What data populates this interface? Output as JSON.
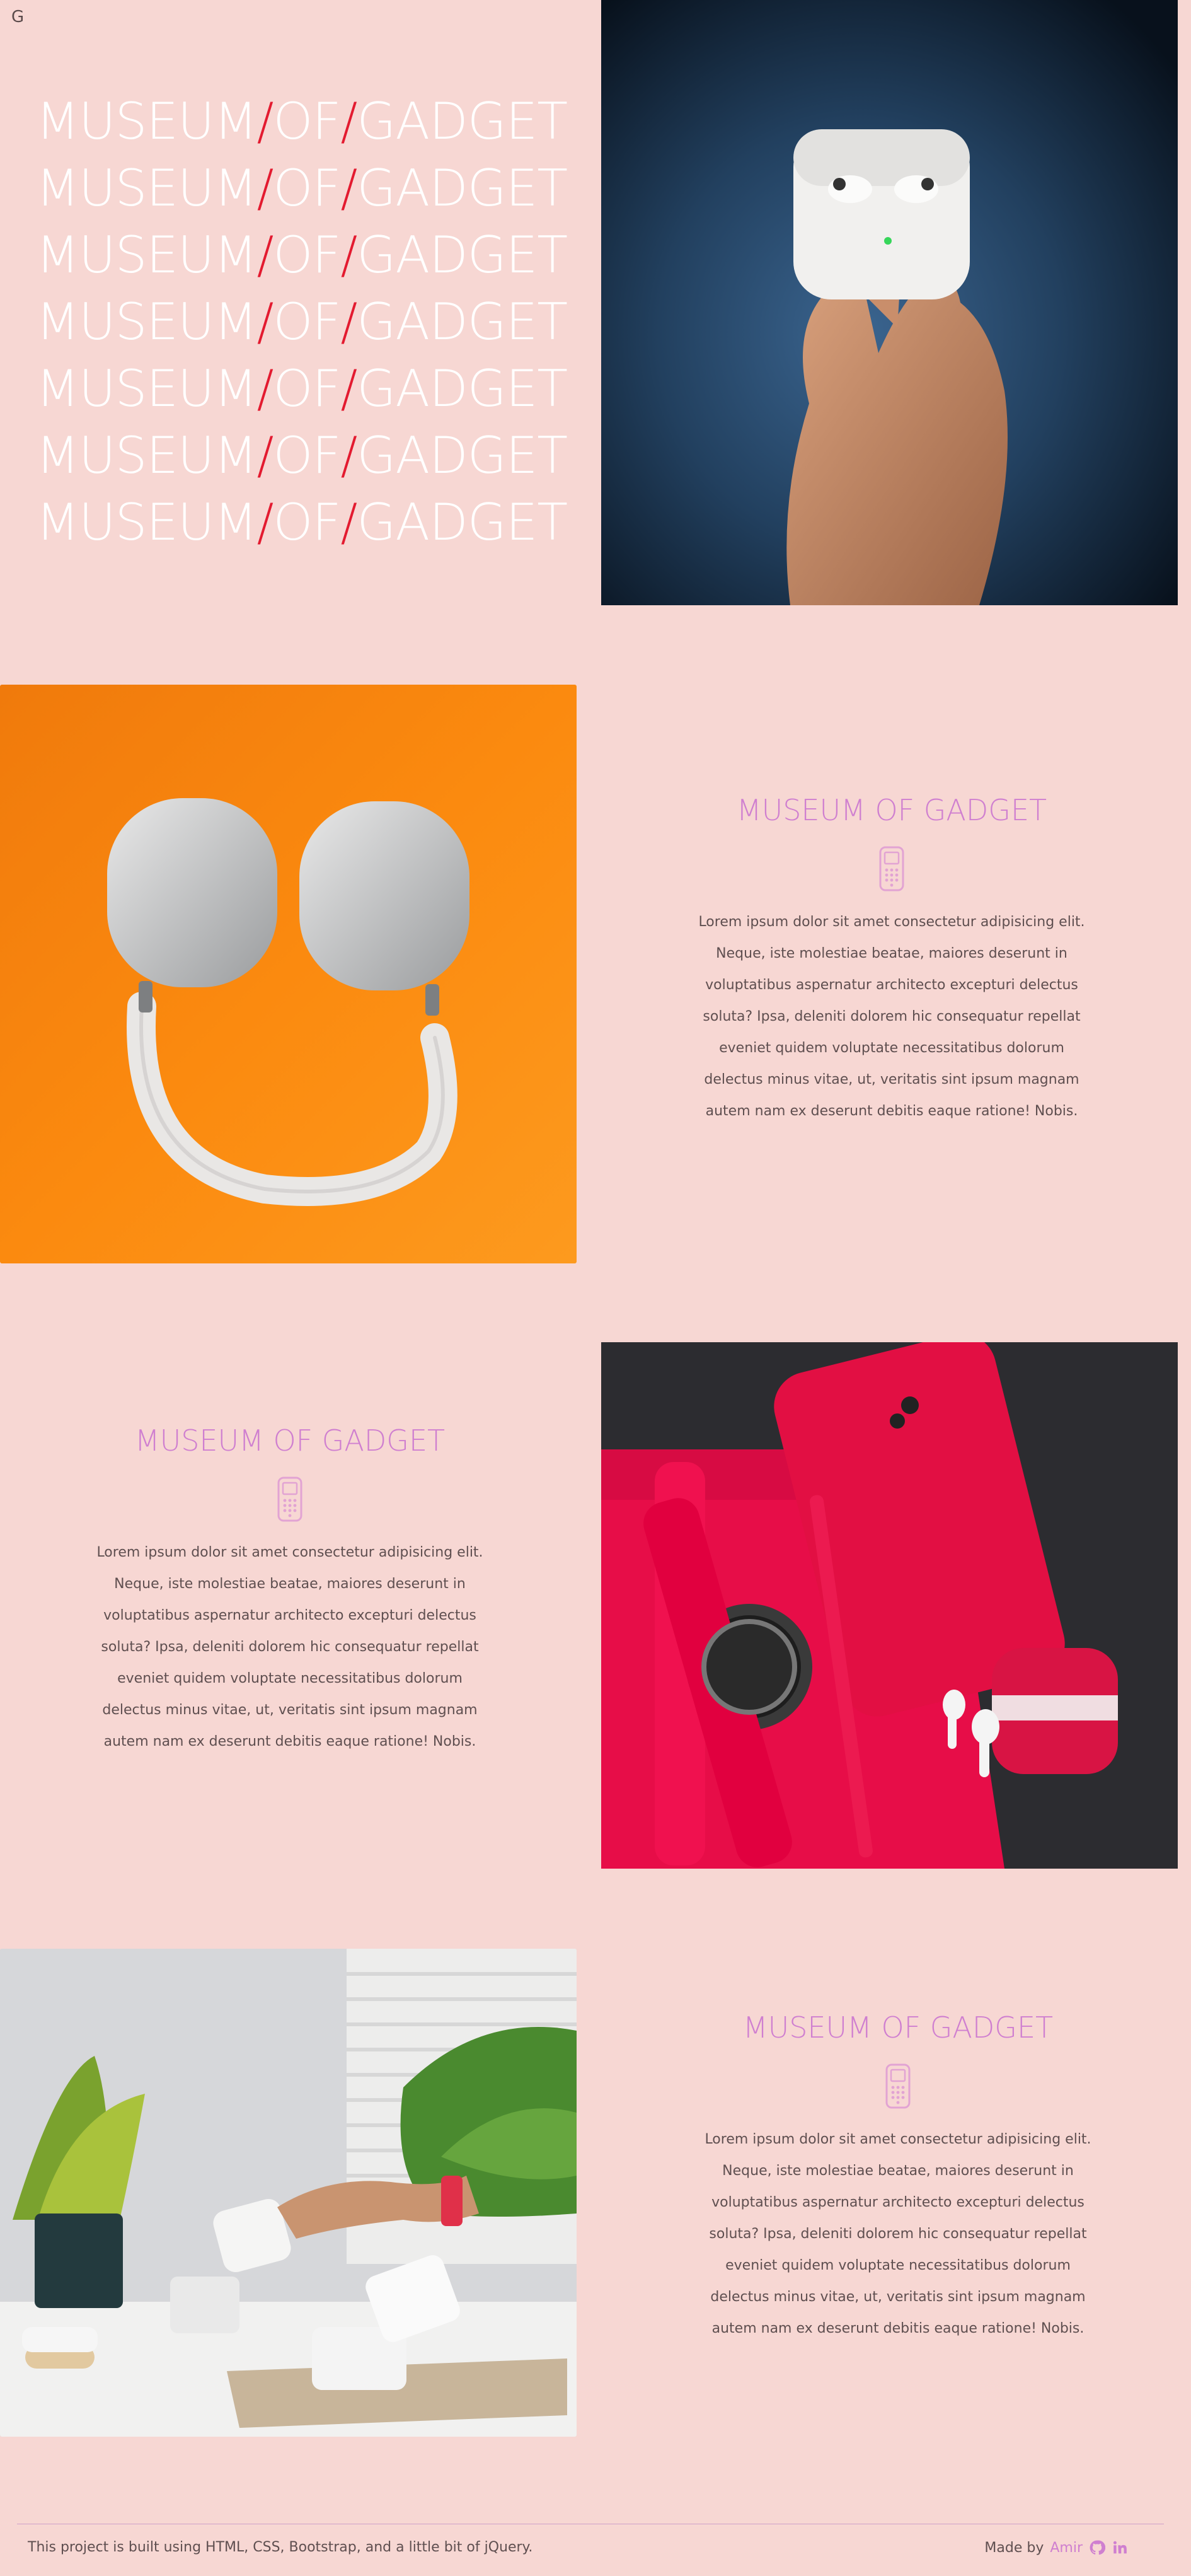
{
  "brand": {
    "corner_mark": "G"
  },
  "hero": {
    "lines": [
      {
        "a": "MUSEUM",
        "s1": "/",
        "b": "OF",
        "s2": "/",
        "c": "GADGET"
      },
      {
        "a": "MUSEUM",
        "s1": "/",
        "b": "OF",
        "s2": "/",
        "c": "GADGET"
      },
      {
        "a": "MUSEUM",
        "s1": "/",
        "b": "OF",
        "s2": "/",
        "c": "GADGET"
      },
      {
        "a": "MUSEUM",
        "s1": "/",
        "b": "OF",
        "s2": "/",
        "c": "GADGET"
      },
      {
        "a": "MUSEUM",
        "s1": "/",
        "b": "OF",
        "s2": "/",
        "c": "GADGET"
      },
      {
        "a": "MUSEUM",
        "s1": "/",
        "b": "OF",
        "s2": "/",
        "c": "GADGET"
      },
      {
        "a": "MUSEUM",
        "s1": "/",
        "b": "OF",
        "s2": "/",
        "c": "GADGET"
      }
    ],
    "slash_color": "#e31b30"
  },
  "sections": [
    {
      "title": "MUSEUM OF GADGET",
      "icon": "mobile-phone-icon",
      "body": "Lorem ipsum dolor sit amet consectetur adipisicing elit. Neque, iste molestiae beatae, maiores deserunt in voluptatibus aspernatur architecto excepturi delectus soluta? Ipsa, deleniti dolorem hic consequatur repellat eveniet quidem voluptate necessitatibus dolorum delectus minus vitae, ut, veritatis sint ipsum magnam autem nam ex deserunt debitis eaque ratione! Nobis."
    },
    {
      "title": "MUSEUM OF GADGET",
      "icon": "mobile-phone-icon",
      "body": "Lorem ipsum dolor sit amet consectetur adipisicing elit. Neque, iste molestiae beatae, maiores deserunt in voluptatibus aspernatur architecto excepturi delectus soluta? Ipsa, deleniti dolorem hic consequatur repellat eveniet quidem voluptate necessitatibus dolorum delectus minus vitae, ut, veritatis sint ipsum magnam autem nam ex deserunt debitis eaque ratione! Nobis."
    },
    {
      "title": "MUSEUM OF GADGET",
      "icon": "mobile-phone-icon",
      "body": "Lorem ipsum dolor sit amet consectetur adipisicing elit. Neque, iste molestiae beatae, maiores deserunt in voluptatibus aspernatur architecto excepturi delectus soluta? Ipsa, deleniti dolorem hic consequatur repellat eveniet quidem voluptate necessitatibus dolorum delectus minus vitae, ut, veritatis sint ipsum magnam autem nam ex deserunt debitis eaque ratione! Nobis."
    }
  ],
  "photos": [
    {
      "name": "airpods-pro-photo",
      "subject": "airpods-icon"
    },
    {
      "name": "airpods-max-photo",
      "subject": "headphones-icon"
    },
    {
      "name": "red-gadgets-photo",
      "subject": "smartphone-icon"
    },
    {
      "name": "charger-photo",
      "subject": "power-adapter-icon"
    }
  ],
  "footer": {
    "note": "This project is built using HTML, CSS, Bootstrap, and a little bit of jQuery.",
    "made_by": "Made by",
    "author": "Amir",
    "icons": [
      "github-icon",
      "linkedin-icon"
    ]
  },
  "colors": {
    "background": "#f7d7d3",
    "accent": "#cf7fd0",
    "text": "#5f4f50",
    "hero_text": "#ffffff"
  }
}
